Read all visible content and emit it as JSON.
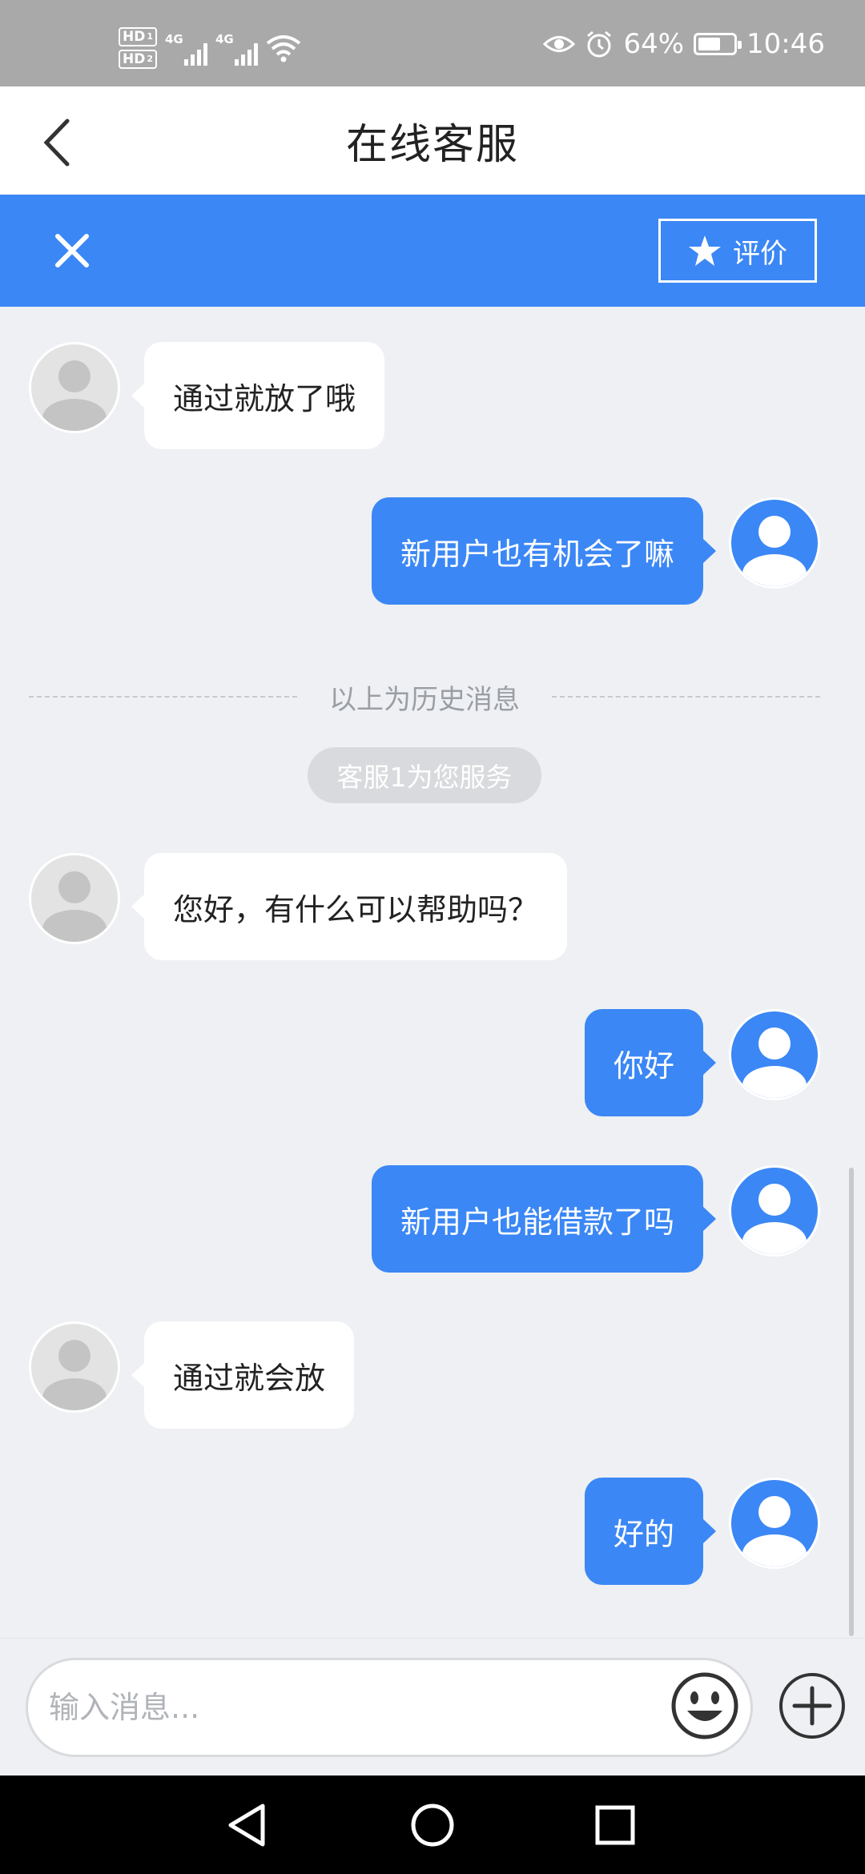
{
  "status_bar": {
    "hd1": "HD",
    "hd1_sub": "1",
    "hd2": "HD",
    "hd2_sub": "2",
    "sim1_network": "4G",
    "sim2_network": "4G",
    "battery_percent_label": "64%",
    "battery_level": 0.64,
    "time": "10:46",
    "icons": [
      "eye-icon",
      "alarm-icon",
      "wifi-icon",
      "signal-icon",
      "battery-icon"
    ]
  },
  "header": {
    "title": "在线客服",
    "back_icon": "chevron-left-icon"
  },
  "toolbar": {
    "close_icon": "close-icon",
    "rate_icon": "star-icon",
    "rate_label": "评价"
  },
  "chat": {
    "history_messages": [
      {
        "sender": "agent",
        "text": "通过就放了哦"
      },
      {
        "sender": "user",
        "text": "新用户也有机会了嘛"
      }
    ],
    "history_divider": "以上为历史消息",
    "service_notice": "客服1为您服务",
    "messages": [
      {
        "sender": "agent",
        "text": "您好，有什么可以帮助吗？"
      },
      {
        "sender": "user",
        "text": "你好"
      },
      {
        "sender": "user",
        "text": "新用户也能借款了吗"
      },
      {
        "sender": "agent",
        "text": "通过就会放"
      },
      {
        "sender": "user",
        "text": "好的"
      }
    ]
  },
  "input": {
    "placeholder": "输入消息...",
    "value": "",
    "emoji_icon": "emoji-icon",
    "plus_icon": "plus-circle-icon"
  },
  "nav_bar": {
    "icons": [
      "back-triangle-icon",
      "home-circle-icon",
      "recents-square-icon"
    ]
  },
  "colors": {
    "accent": "#3b87f5",
    "chat_background": "#eef0f3",
    "status_bar": "#a9a9a9",
    "agent_bubble": "#ffffff"
  }
}
